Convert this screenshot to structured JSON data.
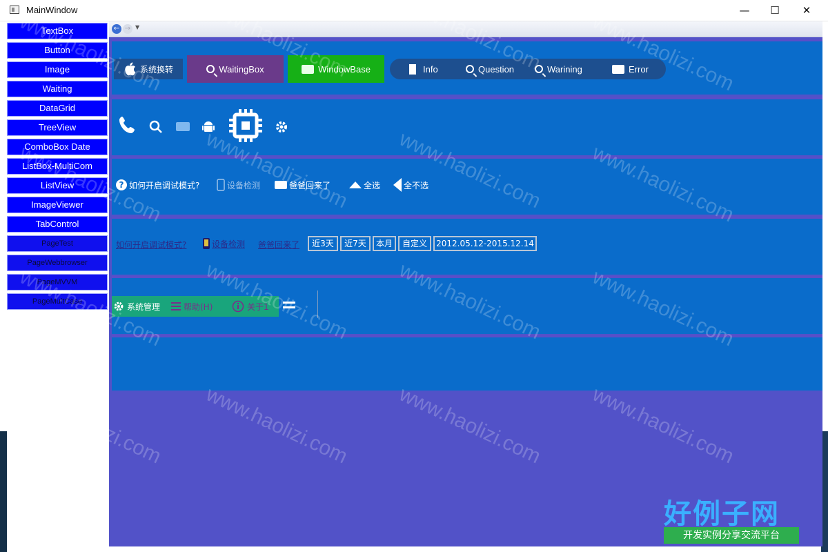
{
  "window": {
    "title": "MainWindow",
    "min_glyph": "—",
    "max_glyph": "☐",
    "close_glyph": "✕"
  },
  "sidebar": {
    "items": [
      {
        "label": "TextBox"
      },
      {
        "label": "Button"
      },
      {
        "label": "Image"
      },
      {
        "label": "Waiting"
      },
      {
        "label": "DataGrid"
      },
      {
        "label": "TreeView"
      },
      {
        "label": "ComboBox Date"
      },
      {
        "label": "ListBox-MultiCom"
      },
      {
        "label": "ListView"
      },
      {
        "label": "ImageViewer"
      },
      {
        "label": "TabControl"
      },
      {
        "label": "PageTest"
      },
      {
        "label": "PageWebbrowser"
      },
      {
        "label": "PageMVVM"
      },
      {
        "label": "PageMultCase"
      }
    ]
  },
  "browser": {
    "back_glyph": "←",
    "fwd_glyph": "→",
    "drop_glyph": "▼"
  },
  "row1": {
    "sys_switch": "系统换转",
    "waiting_box": "WaitingBox",
    "window_base": "WindowBase",
    "info": "Info",
    "question": "Question",
    "warning": "Warining",
    "error": "Error"
  },
  "row3": {
    "debug_mode": "如何开启调试模式?",
    "device_check": "设备检测",
    "dad_back": "爸爸回来了",
    "select_all": "全选",
    "select_none": "全不选"
  },
  "row4": {
    "debug_mode": "如何开启调试模式?",
    "device_check": "设备检测",
    "dad_back": "爸爸回来了",
    "date_buttons": [
      "近3天",
      "近7天",
      "本月",
      "自定义"
    ],
    "date_range": "2012.05.12-2015.12.14"
  },
  "row5": {
    "sys_manage": "系统管理",
    "help": "帮助(H)",
    "about": "关于1"
  },
  "watermark": "www.haolizi.com",
  "brand": {
    "main": "好例子网",
    "sub": "开发实例分享交流平台"
  },
  "colors": {
    "accent": "#0000ff",
    "panel": "#0a6ccb",
    "background": "#5252c8",
    "menu": "#19a57c"
  }
}
